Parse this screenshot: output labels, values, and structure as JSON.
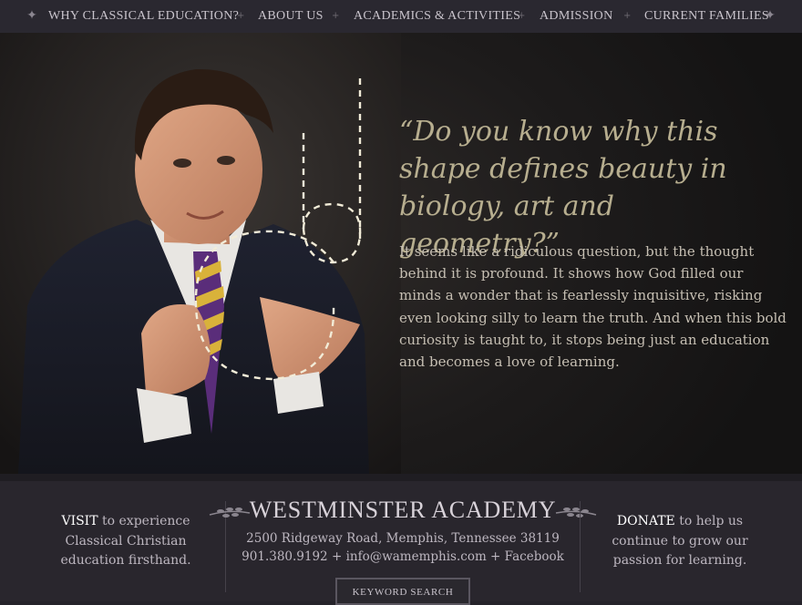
{
  "nav": {
    "items": [
      {
        "label": "WHY CLASSICAL EDUCATION?"
      },
      {
        "label": "ABOUT US"
      },
      {
        "label": "ACADEMICS & ACTIVITIES"
      },
      {
        "label": "ADMISSION"
      },
      {
        "label": "CURRENT FAMILIES"
      }
    ],
    "separator": "+",
    "end_icon": "ornament-icon"
  },
  "hero": {
    "quote": "“Do you know why this shape defines beauty in biology, art and geometry?”",
    "body": "It seems like a ridiculous question, but the thought behind it is profound. It shows how God filled our minds a wonder that is fearlessly inquisitive, risking even looking silly to learn the truth. And when this bold curiosity is taught to, it stops being just an education and becomes a love of learning.",
    "photo": "student-photo"
  },
  "footer": {
    "visit": {
      "strong": "VISIT",
      "rest": " to experience Classical Christian education firsthand."
    },
    "brand": "WESTMINSTER ACADEMY",
    "address": "2500 Ridgeway Road, Memphis, Tennessee 38119",
    "contact": {
      "phone": "901.380.9192",
      "sep": " + ",
      "email": "info@wamemphis.com",
      "social": "Facebook"
    },
    "donate": {
      "strong": "DONATE",
      "rest": " to help us continue to grow our passion for learning."
    },
    "search_label": "KEYWORD SEARCH"
  },
  "colors": {
    "quote": "#b7ae8f",
    "body": "#c6bfb3",
    "nav_bg": "#2a2830",
    "footer_bg": "#29262d"
  }
}
